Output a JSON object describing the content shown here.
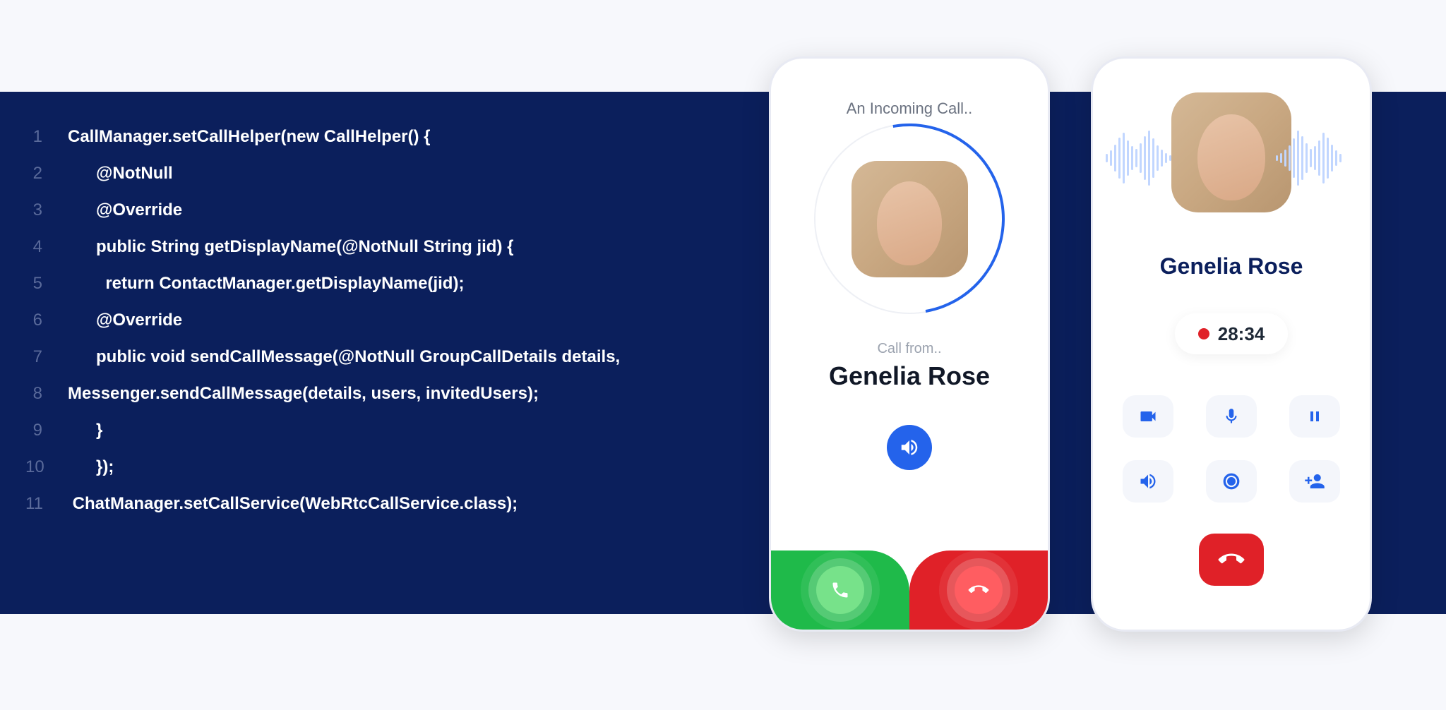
{
  "code": {
    "lines": [
      "CallManager.setCallHelper(new CallHelper() {",
      "      @NotNull",
      "      @Override",
      "      public String getDisplayName(@NotNull String jid) {",
      "        return ContactManager.getDisplayName(jid);",
      "      @Override",
      "      public void sendCallMessage(@NotNull GroupCallDetails details,",
      "Messenger.sendCallMessage(details, users, invitedUsers);",
      "      }",
      "      });",
      " ChatManager.setCallService(WebRtcCallService.class);"
    ]
  },
  "incoming": {
    "header": "An Incoming Call..",
    "call_from": "Call from..",
    "caller_name": "Genelia Rose"
  },
  "active": {
    "caller_name": "Genelia Rose",
    "timer": "28:34"
  }
}
